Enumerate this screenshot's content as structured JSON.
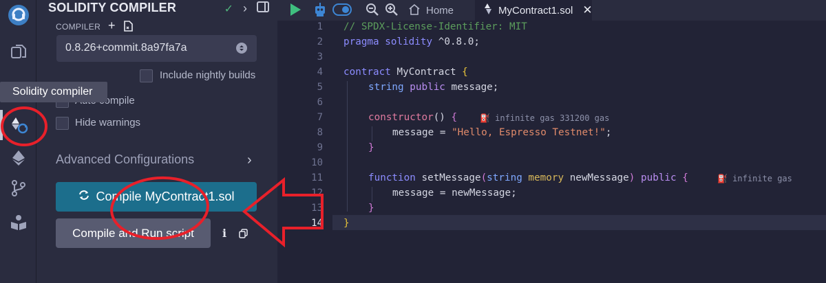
{
  "tooltip": {
    "text": "Solidity compiler"
  },
  "panel": {
    "title": "SOLIDITY COMPILER",
    "compiler_label": "COMPILER",
    "compiler_version": "0.8.26+commit.8a97fa7a",
    "include_nightly_label": "Include nightly builds",
    "auto_compile_label": "Auto compile",
    "hide_warnings_label": "Hide warnings",
    "advanced_label": "Advanced Configurations",
    "compile_button": "Compile MyContract1.sol",
    "run_button": "Compile and Run script"
  },
  "tabs": {
    "home": "Home",
    "active": "MyContract1.sol"
  },
  "editor": {
    "line_numbers": [
      "1",
      "2",
      "3",
      "4",
      "5",
      "6",
      "7",
      "8",
      "9",
      "10",
      "11",
      "12",
      "13",
      "14"
    ],
    "gas_constructor": "infinite gas 331200 gas",
    "gas_function": "infinite gas",
    "lines": {
      "l1": "// SPDX-License-Identifier: MIT",
      "l2_kw": "pragma solidity",
      "l2_ver": " ^0.8.0;",
      "l4_kw": "contract",
      "l4_name": " MyContract ",
      "l4_br": "{",
      "l5_ty": "string",
      "l5_pub": " public",
      "l5_rest": " message;",
      "l7_fn": "constructor",
      "l7_rest": "() ",
      "l7_br": "{",
      "l8_a": "message = ",
      "l8_str": "\"Hello, Espresso Testnet!\"",
      "l8_b": ";",
      "l9_br": "}",
      "l11_kw": "function",
      "l11_name": " setMessage",
      "l11_p": "(",
      "l11_ty": "string",
      "l11_mem": " memory",
      "l11_arg": " newMessage",
      "l11_p2": ")",
      "l11_pub": " public",
      "l11_br": " {",
      "l12": "message = newMessage;",
      "l13_br": "}",
      "l14_br": "}"
    }
  },
  "colors": {
    "accent": "#1c6e8c",
    "annotation": "#e8202a"
  }
}
